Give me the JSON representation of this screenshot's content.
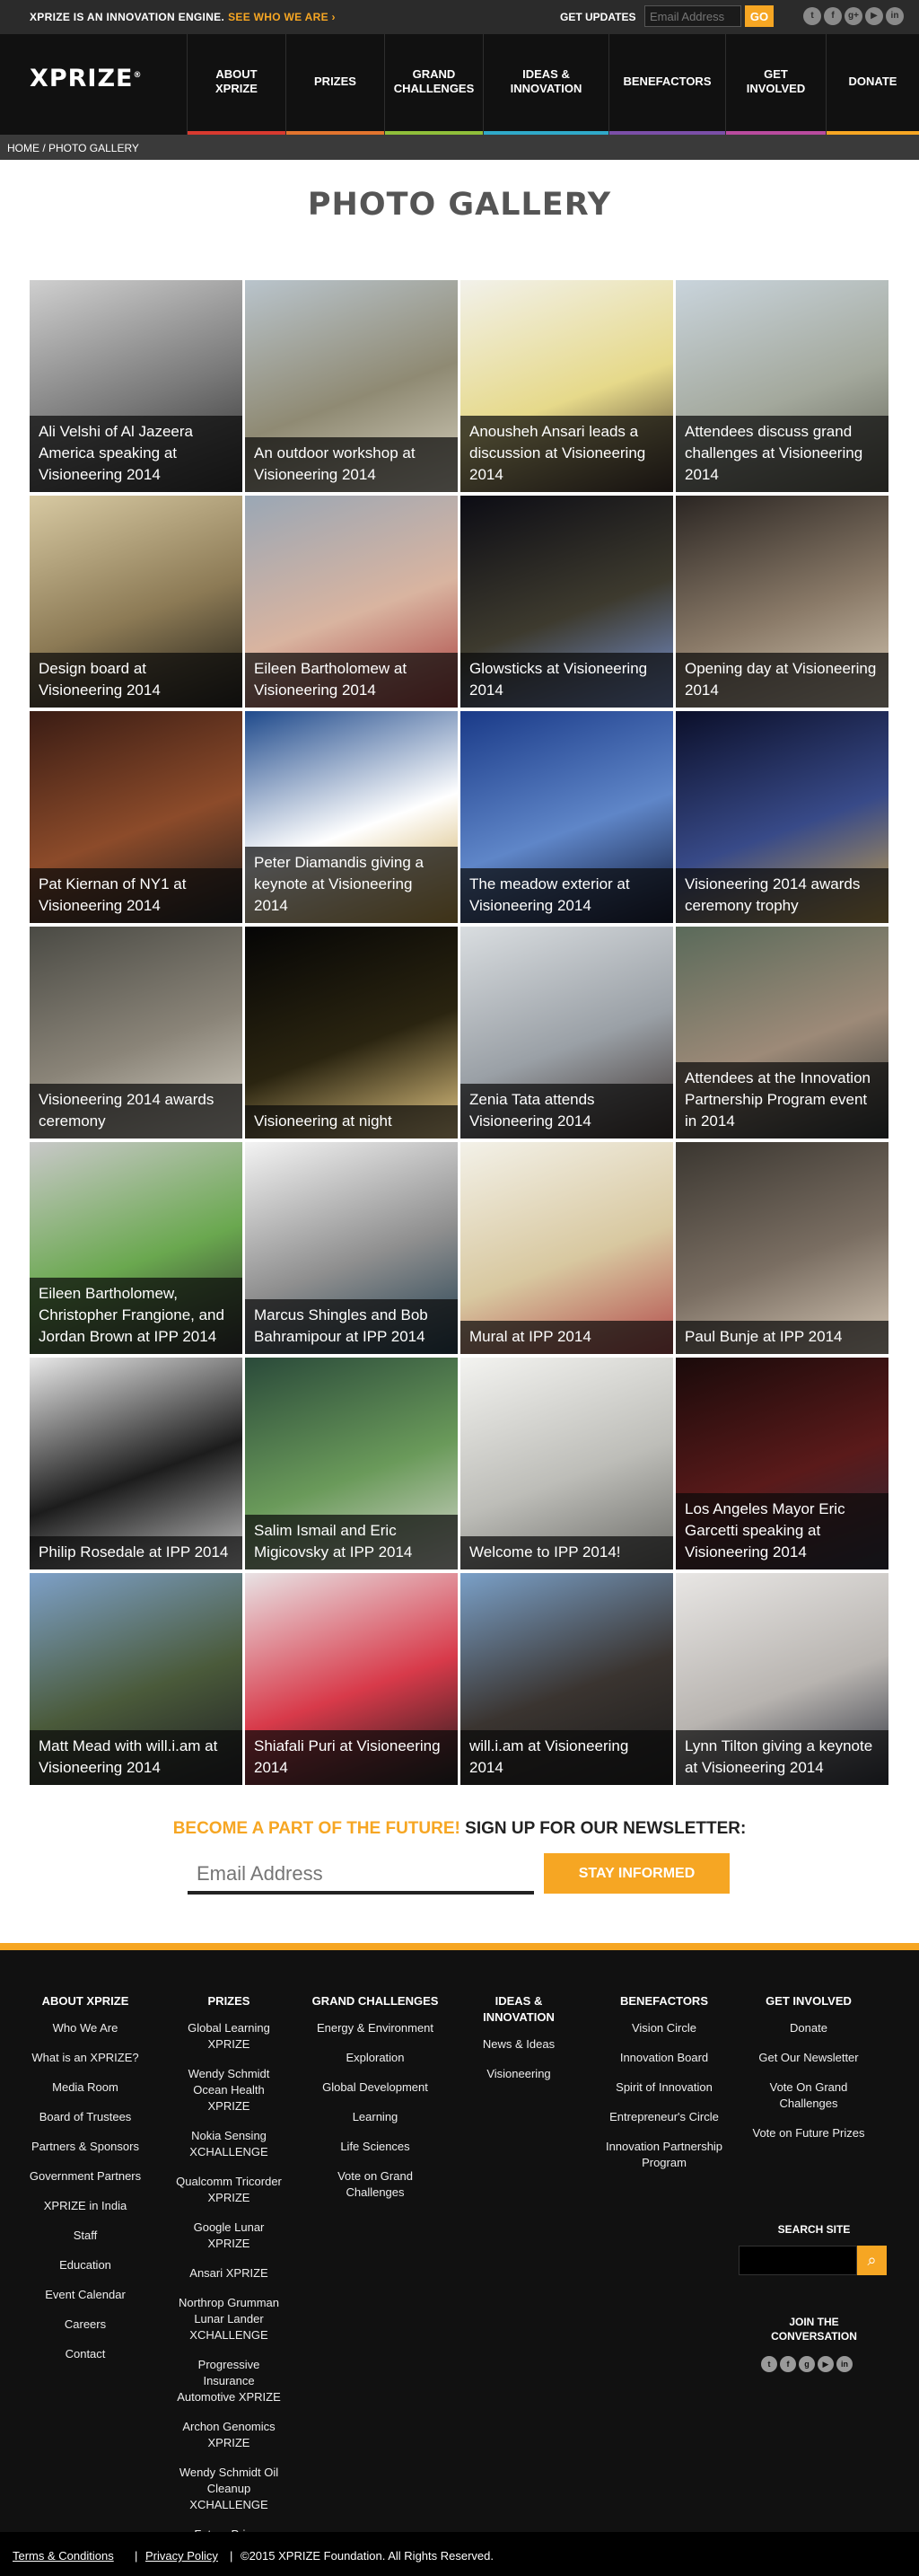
{
  "topbar": {
    "tagline": "XPRIZE IS AN INNOVATION ENGINE.",
    "tagline_link": "SEE WHO WE ARE ›",
    "get_updates": "GET UPDATES",
    "email_placeholder": "Email Address",
    "go_label": "GO",
    "social_icons": [
      "twitter-icon",
      "facebook-icon",
      "google-plus-icon",
      "youtube-icon",
      "linkedin-icon"
    ]
  },
  "header": {
    "logo": "XPRIZE",
    "nav": [
      {
        "label": "ABOUT\nXPRIZE",
        "color": "#d83a2f"
      },
      {
        "label": "PRIZES",
        "color": "#e2742e"
      },
      {
        "label": "GRAND\nCHALLENGES",
        "color": "#8fbf3a"
      },
      {
        "label": "IDEAS &\nINNOVATION",
        "color": "#2fa9c9"
      },
      {
        "label": "BENEFACTORS",
        "color": "#7b4fa8"
      },
      {
        "label": "GET\nINVOLVED",
        "color": "#b94b9e"
      },
      {
        "label": "DONATE",
        "color": "#f6a623"
      }
    ]
  },
  "breadcrumb": "HOME / PHOTO GALLERY",
  "page_title": "PHOTO GALLERY",
  "gallery": [
    {
      "caption": "Ali Velshi of Al Jazeera America speaking at Visioneering 2014"
    },
    {
      "caption": "An outdoor workshop at Visioneering 2014"
    },
    {
      "caption": "Anousheh Ansari leads a discussion at Visioneering 2014"
    },
    {
      "caption": "Attendees discuss grand challenges at Visioneering 2014"
    },
    {
      "caption": "Design board at Visioneering 2014"
    },
    {
      "caption": "Eileen Bartholomew at Visioneering 2014"
    },
    {
      "caption": "Glowsticks at Visioneering 2014"
    },
    {
      "caption": "Opening day at Visioneering 2014"
    },
    {
      "caption": "Pat Kiernan of NY1 at Visioneering 2014"
    },
    {
      "caption": "Peter Diamandis giving a keynote at Visioneering 2014"
    },
    {
      "caption": "The meadow exterior at Visioneering 2014"
    },
    {
      "caption": "Visioneering 2014 awards ceremony trophy"
    },
    {
      "caption": "Visioneering 2014 awards ceremony"
    },
    {
      "caption": "Visioneering at night"
    },
    {
      "caption": "Zenia Tata attends Visioneering 2014"
    },
    {
      "caption": "Attendees at the Innovation Partnership Program event in 2014"
    },
    {
      "caption": "Eileen Bartholomew, Christopher Frangione, and Jordan Brown at IPP 2014"
    },
    {
      "caption": "Marcus Shingles and Bob Bahramipour at IPP 2014"
    },
    {
      "caption": "Mural at IPP 2014"
    },
    {
      "caption": "Paul Bunje at IPP 2014"
    },
    {
      "caption": "Philip Rosedale at IPP 2014"
    },
    {
      "caption": "Salim Ismail and Eric Migicovsky at IPP 2014"
    },
    {
      "caption": "Welcome to IPP 2014!"
    },
    {
      "caption": "Los Angeles Mayor Eric Garcetti speaking at Visioneering 2014"
    },
    {
      "caption": "Matt Mead with will.i.am at Visioneering 2014"
    },
    {
      "caption": "Shiafali Puri at Visioneering 2014"
    },
    {
      "caption": "will.i.am at Visioneering 2014"
    },
    {
      "caption": "Lynn Tilton giving a keynote at Visioneering 2014"
    }
  ],
  "newsletter": {
    "highlight": "BECOME A PART OF THE FUTURE!",
    "title": "SIGN UP FOR OUR NEWSLETTER:",
    "placeholder": "Email Address",
    "button": "STAY INFORMED"
  },
  "footer": {
    "columns": [
      {
        "title": "ABOUT XPRIZE",
        "links": [
          "Who We Are",
          "What is an XPRIZE?",
          "Media Room",
          "Board of Trustees",
          "Partners & Sponsors",
          "Government Partners",
          "XPRIZE in India",
          "Staff",
          "Education",
          "Event Calendar",
          "Careers",
          "Contact"
        ]
      },
      {
        "title": "PRIZES",
        "links": [
          "Global Learning XPRIZE",
          "Wendy Schmidt Ocean Health XPRIZE",
          "Nokia Sensing XCHALLENGE",
          "Qualcomm Tricorder XPRIZE",
          "Google Lunar XPRIZE",
          "Ansari XPRIZE",
          "Northrop Grumman Lunar Lander XCHALLENGE",
          "Progressive Insurance Automotive XPRIZE",
          "Archon Genomics XPRIZE",
          "Wendy Schmidt Oil Cleanup XCHALLENGE",
          "Future Prizes"
        ]
      },
      {
        "title": "GRAND CHALLENGES",
        "links": [
          "Energy & Environment",
          "Exploration",
          "Global Development",
          "Learning",
          "Life Sciences",
          "Vote on Grand Challenges"
        ]
      },
      {
        "title": "IDEAS & INNOVATION",
        "links": [
          "News & Ideas",
          "Visioneering"
        ]
      },
      {
        "title": "BENEFACTORS",
        "links": [
          "Vision Circle",
          "Innovation Board",
          "Spirit of Innovation",
          "Entrepreneur's Circle",
          "Innovation Partnership Program"
        ]
      },
      {
        "title": "GET INVOLVED",
        "links": [
          "Donate",
          "Get Our Newsletter",
          "Vote On Grand Challenges",
          "Vote on Future Prizes"
        ]
      }
    ],
    "search_title": "SEARCH SITE",
    "join_title": "JOIN THE CONVERSATION",
    "legal": {
      "terms": "Terms & Conditions",
      "privacy": "Privacy Policy",
      "copyright": "©2015 XPRIZE Foundation. All Rights Reserved."
    }
  }
}
